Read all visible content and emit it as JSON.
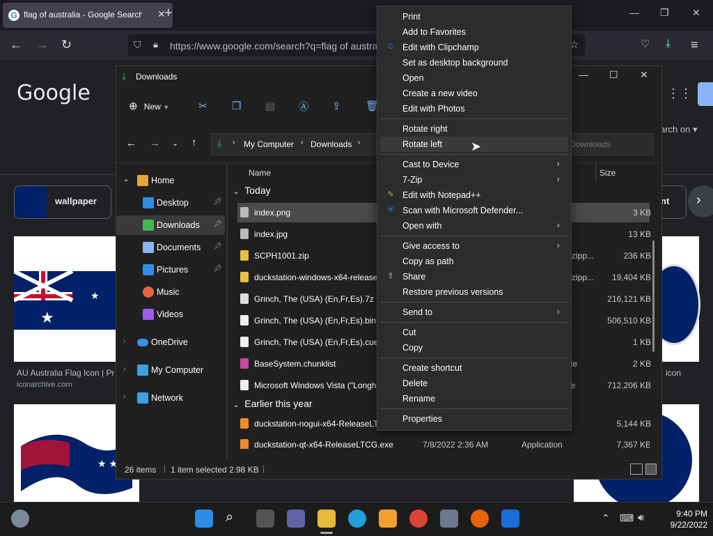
{
  "browser": {
    "tab_title": "flag of australia - Google Search",
    "tab_close": "✕",
    "new_tab": "+",
    "url": "https://www.google.com/search?q=flag of austra"
  },
  "google": {
    "logo": "Google",
    "search_on": "arch on ▾",
    "chip_wallpaper": "wallpaper",
    "chip_right": "nt",
    "result1_title": "AU Australia Flag Icon | Pr",
    "result1_source": "iconarchive.com",
    "result_right_title": "icon",
    "brand_color": "#4285f4"
  },
  "explorer": {
    "title": "Downloads",
    "toolbar": {
      "new_label": "New"
    },
    "breadcrumb": [
      "My Computer",
      "Downloads"
    ],
    "search_placeholder": "Downloads",
    "col_name": "Name",
    "col_size": "Size",
    "nav": [
      {
        "label": "Home"
      },
      {
        "label": "Desktop"
      },
      {
        "label": "Downloads"
      },
      {
        "label": "Documents"
      },
      {
        "label": "Pictures"
      },
      {
        "label": "Music"
      },
      {
        "label": "Videos"
      },
      {
        "label": "OneDrive"
      },
      {
        "label": "My Computer"
      },
      {
        "label": "Network"
      }
    ],
    "group_today": "Today",
    "group_earlier": "Earlier this year",
    "files_today": [
      {
        "name": "index.png",
        "type": "",
        "size": "3 KB"
      },
      {
        "name": "index.jpg",
        "type": "",
        "size": "13 KB"
      },
      {
        "name": "SCPH1001.zip",
        "type": "(zipp...",
        "size": "236 KB"
      },
      {
        "name": "duckstation-windows-x64-release",
        "type": "(zipp...",
        "size": "19,404 KB"
      },
      {
        "name": "Grinch, The (USA) (En,Fr,Es).7z",
        "type": "",
        "size": "216,121 KB"
      },
      {
        "name": "Grinch, The (USA) (En,Fr,Es).bin",
        "type": "",
        "size": "506,510 KB"
      },
      {
        "name": "Grinch, The (USA) (En,Fr,Es).cue",
        "type": "",
        "size": "1 KB"
      },
      {
        "name": "BaseSystem.chunklist",
        "type": "ile",
        "size": "2 KB"
      },
      {
        "name": "Microsoft Windows Vista (\"Longh",
        "type": "le",
        "size": "712,206 KB"
      }
    ],
    "files_earlier": [
      {
        "name": "duckstation-nogui-x64-ReleaseLTC",
        "date": "",
        "type": "",
        "size": "5,144 KB"
      },
      {
        "name": "duckstation-qt-x64-ReleaseLTCG.exe",
        "date": "7/8/2022 2:36 AM",
        "type": "Application",
        "size": "7,367 KB"
      }
    ],
    "status": {
      "items": "26 items",
      "selected": "1 item selected",
      "size": "2.98 KB"
    }
  },
  "context_menu": {
    "g1": [
      "Print",
      "Add to Favorites",
      "Edit with Clipchamp",
      "Set as desktop background",
      "Open",
      "Create a new video",
      "Edit with Photos"
    ],
    "g2": [
      "Rotate right",
      "Rotate left"
    ],
    "g3": [
      "Cast to Device",
      "7-Zip",
      "Edit with Notepad++",
      "Scan with Microsoft Defender...",
      "Open with"
    ],
    "g4": [
      "Give access to",
      "Copy as path",
      "Share",
      "Restore previous versions"
    ],
    "g5": [
      "Send to"
    ],
    "g6": [
      "Cut",
      "Copy"
    ],
    "g7": [
      "Create shortcut",
      "Delete",
      "Rename"
    ],
    "g8": [
      "Properties"
    ]
  },
  "taskbar": {
    "time": "9:40 PM",
    "date": "9/22/2022"
  }
}
